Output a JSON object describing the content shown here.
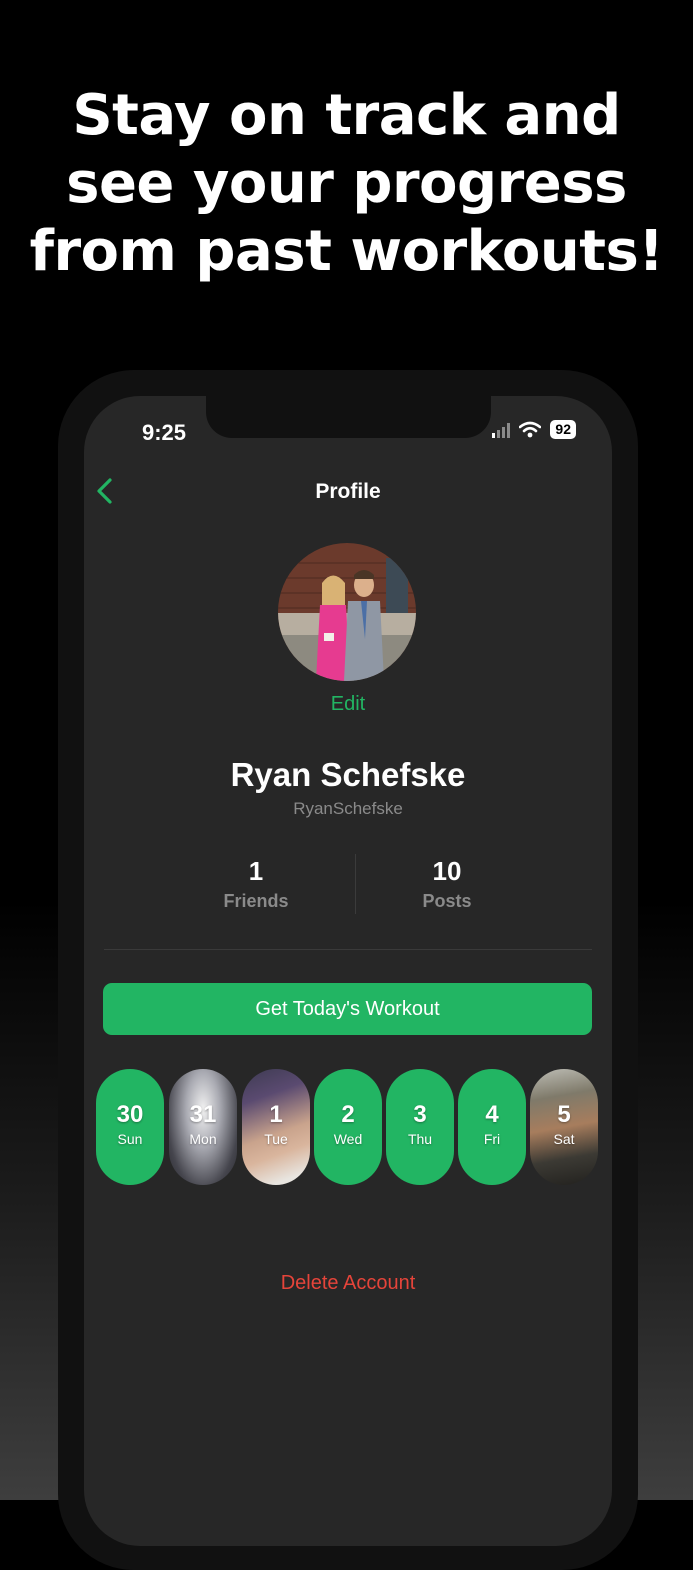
{
  "headline": {
    "line1": "Stay on track and",
    "line2": "see your progress",
    "line3": "from past workouts!"
  },
  "status_bar": {
    "time": "9:25",
    "battery": "92"
  },
  "nav": {
    "title": "Profile"
  },
  "profile": {
    "edit_label": "Edit",
    "name": "Ryan Schefske",
    "username": "RyanSchefske"
  },
  "stats": [
    {
      "value": "1",
      "label": "Friends"
    },
    {
      "value": "10",
      "label": "Posts"
    }
  ],
  "cta": {
    "label": "Get Today's Workout"
  },
  "days": [
    {
      "num": "30",
      "label": "Sun"
    },
    {
      "num": "31",
      "label": "Mon"
    },
    {
      "num": "1",
      "label": "Tue"
    },
    {
      "num": "2",
      "label": "Wed"
    },
    {
      "num": "3",
      "label": "Thu"
    },
    {
      "num": "4",
      "label": "Fri"
    },
    {
      "num": "5",
      "label": "Sat"
    }
  ],
  "delete_label": "Delete Account",
  "colors": {
    "accent": "#22b563",
    "danger": "#e5443a",
    "background": "#272727"
  }
}
